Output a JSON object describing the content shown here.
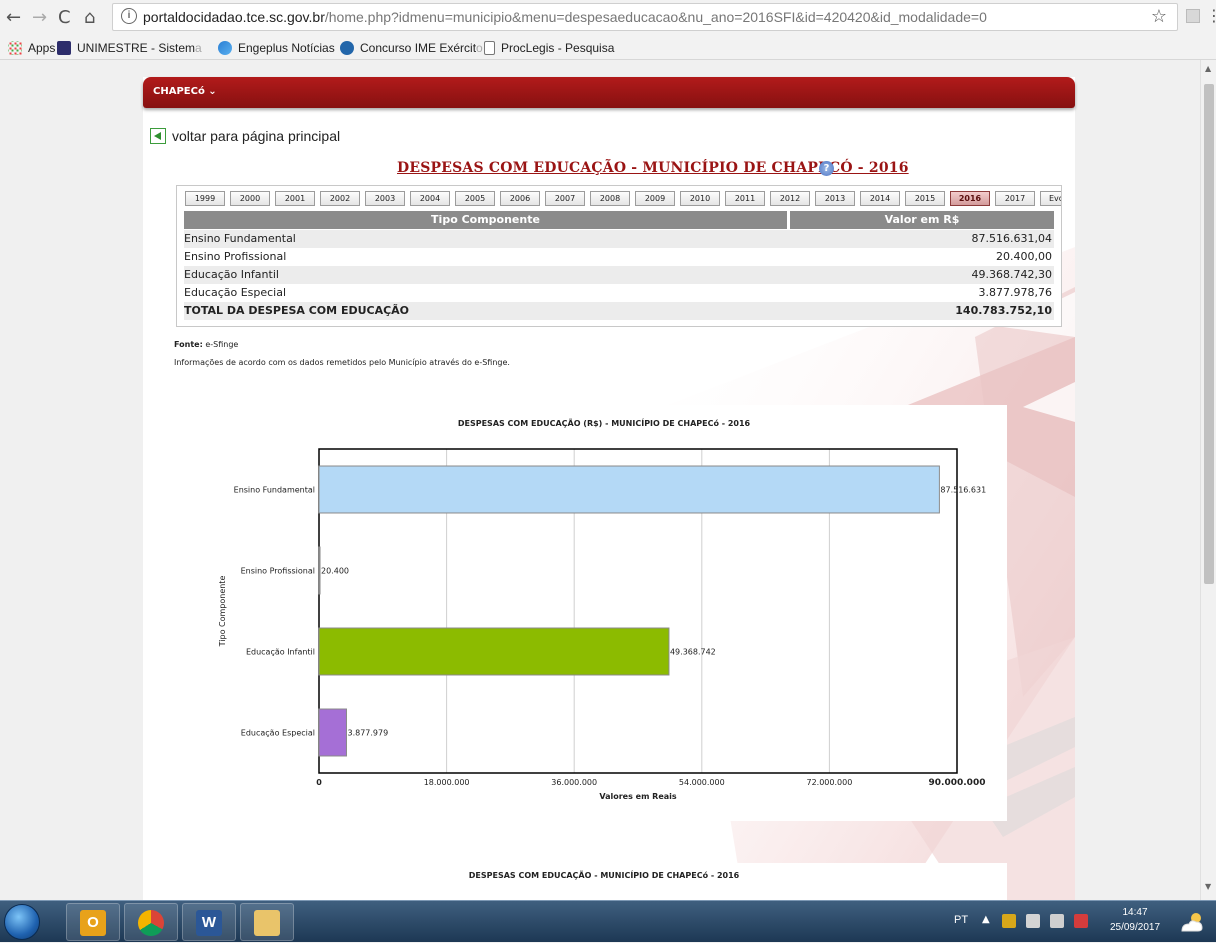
{
  "browser": {
    "url_host": "portaldocidadao.tce.sc.gov.br",
    "url_path": "/home.php?idmenu=municipio&menu=despesaeducacao&nu_ano=2016SFI&id=420420&id_modalidade=0",
    "bookmarks": [
      {
        "label": "Apps",
        "icon": "apps-grid-icon",
        "faded": ""
      },
      {
        "label": "UNIMESTRE - Sistem",
        "icon": "unimestre-icon",
        "faded": "a"
      },
      {
        "label": "Engeplus Notícias",
        "icon": "engeplus-icon",
        "faded": ""
      },
      {
        "label": "Concurso IME Exércit",
        "icon": "ime-icon",
        "faded": "o"
      },
      {
        "label": "ProcLegis - Pesquisa",
        "icon": "page-icon",
        "faded": ""
      }
    ]
  },
  "page": {
    "municipality_menu": "CHAPECó ⌄",
    "back_link": "voltar para página principal",
    "title": "DESPESAS COM EDUCAÇÃO - MUNICÍPIO DE CHAPECÓ - 2016",
    "year_tabs": [
      "1999",
      "2000",
      "2001",
      "2002",
      "2003",
      "2004",
      "2005",
      "2006",
      "2007",
      "2008",
      "2009",
      "2010",
      "2011",
      "2012",
      "2013",
      "2014",
      "2015",
      "2016",
      "2017",
      "Evolu"
    ],
    "active_year": "2016",
    "table": {
      "headers": [
        "Tipo Componente",
        "Valor em R$"
      ],
      "rows": [
        {
          "tipo": "Ensino Fundamental",
          "valor": "87.516.631,04"
        },
        {
          "tipo": "Ensino Profissional",
          "valor": "20.400,00"
        },
        {
          "tipo": "Educação Infantil",
          "valor": "49.368.742,30"
        },
        {
          "tipo": "Educação Especial",
          "valor": "3.877.978,76"
        }
      ],
      "total": {
        "tipo": "TOTAL DA DESPESA COM EDUCAÇÃO",
        "valor": "140.783.752,10"
      }
    },
    "source_label": "Fonte:",
    "source_value": "e-Sfinge",
    "source_note": "Informações de acordo com os dados remetidos pelo Município através do e-Sfinge.",
    "second_chart_title": "DESPESAS COM EDUCAÇÃO - MUNICÍPIO DE CHAPECó - 2016"
  },
  "chart_data": {
    "type": "bar",
    "orientation": "horizontal",
    "title": "DESPESAS COM EDUCAÇÃO (R$) - MUNICÍPIO DE CHAPECó - 2016",
    "xlabel": "Valores em Reais",
    "ylabel": "Tipo Componente",
    "categories": [
      "Ensino Fundamental",
      "Ensino Profissional",
      "Educação Infantil",
      "Educação Especial"
    ],
    "values": [
      87516631,
      20400,
      49368742,
      3877979
    ],
    "value_labels": [
      "87.516.631",
      "20.400",
      "49.368.742",
      "3.877.979"
    ],
    "colors": [
      "#b4d9f6",
      "#c8c8c8",
      "#8cbb00",
      "#a56fd6"
    ],
    "xlim": [
      0,
      90000000
    ],
    "xticks": [
      0,
      18000000,
      36000000,
      54000000,
      72000000,
      90000000
    ],
    "xtick_labels": [
      "0",
      "18.000.000",
      "36.000.000",
      "54.000.000",
      "72.000.000",
      "90.000.000"
    ],
    "grid": true
  },
  "taskbar": {
    "apps": [
      "outlook-icon",
      "chrome-icon",
      "word-icon",
      "file-explorer-icon"
    ],
    "lang": "PT",
    "time": "14:47",
    "date": "25/09/2017"
  }
}
